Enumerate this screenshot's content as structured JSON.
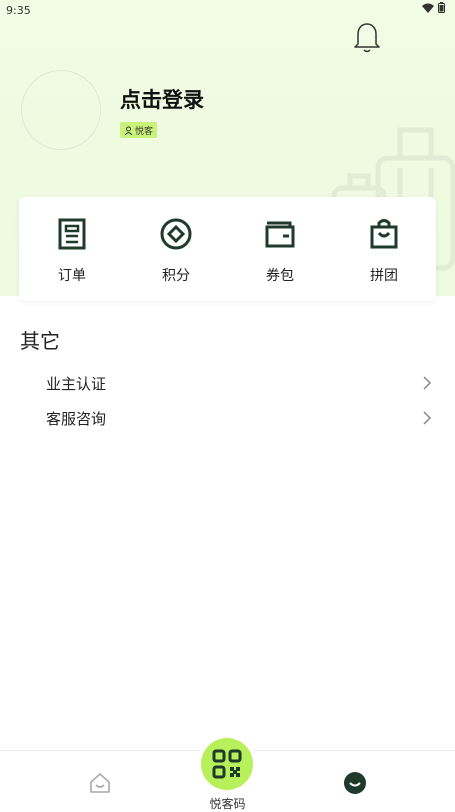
{
  "status_bar": {
    "time": "9:35"
  },
  "profile": {
    "login_label": "点击登录",
    "member_badge": "悦客"
  },
  "quick_actions": [
    {
      "label": "订单",
      "icon": "order-list-icon"
    },
    {
      "label": "积分",
      "icon": "points-coin-icon"
    },
    {
      "label": "券包",
      "icon": "wallet-icon"
    },
    {
      "label": "拼团",
      "icon": "shopping-bag-icon"
    }
  ],
  "other": {
    "title": "其它",
    "items": [
      {
        "label": "业主认证"
      },
      {
        "label": "客服咨询"
      }
    ]
  },
  "tabbar": {
    "code_label": "悦客码"
  },
  "colors": {
    "accent": "#b7f05a",
    "badge": "#c9f27a",
    "hero_bg": "#f2fbe4",
    "icon_dark": "#1e3a2a"
  }
}
